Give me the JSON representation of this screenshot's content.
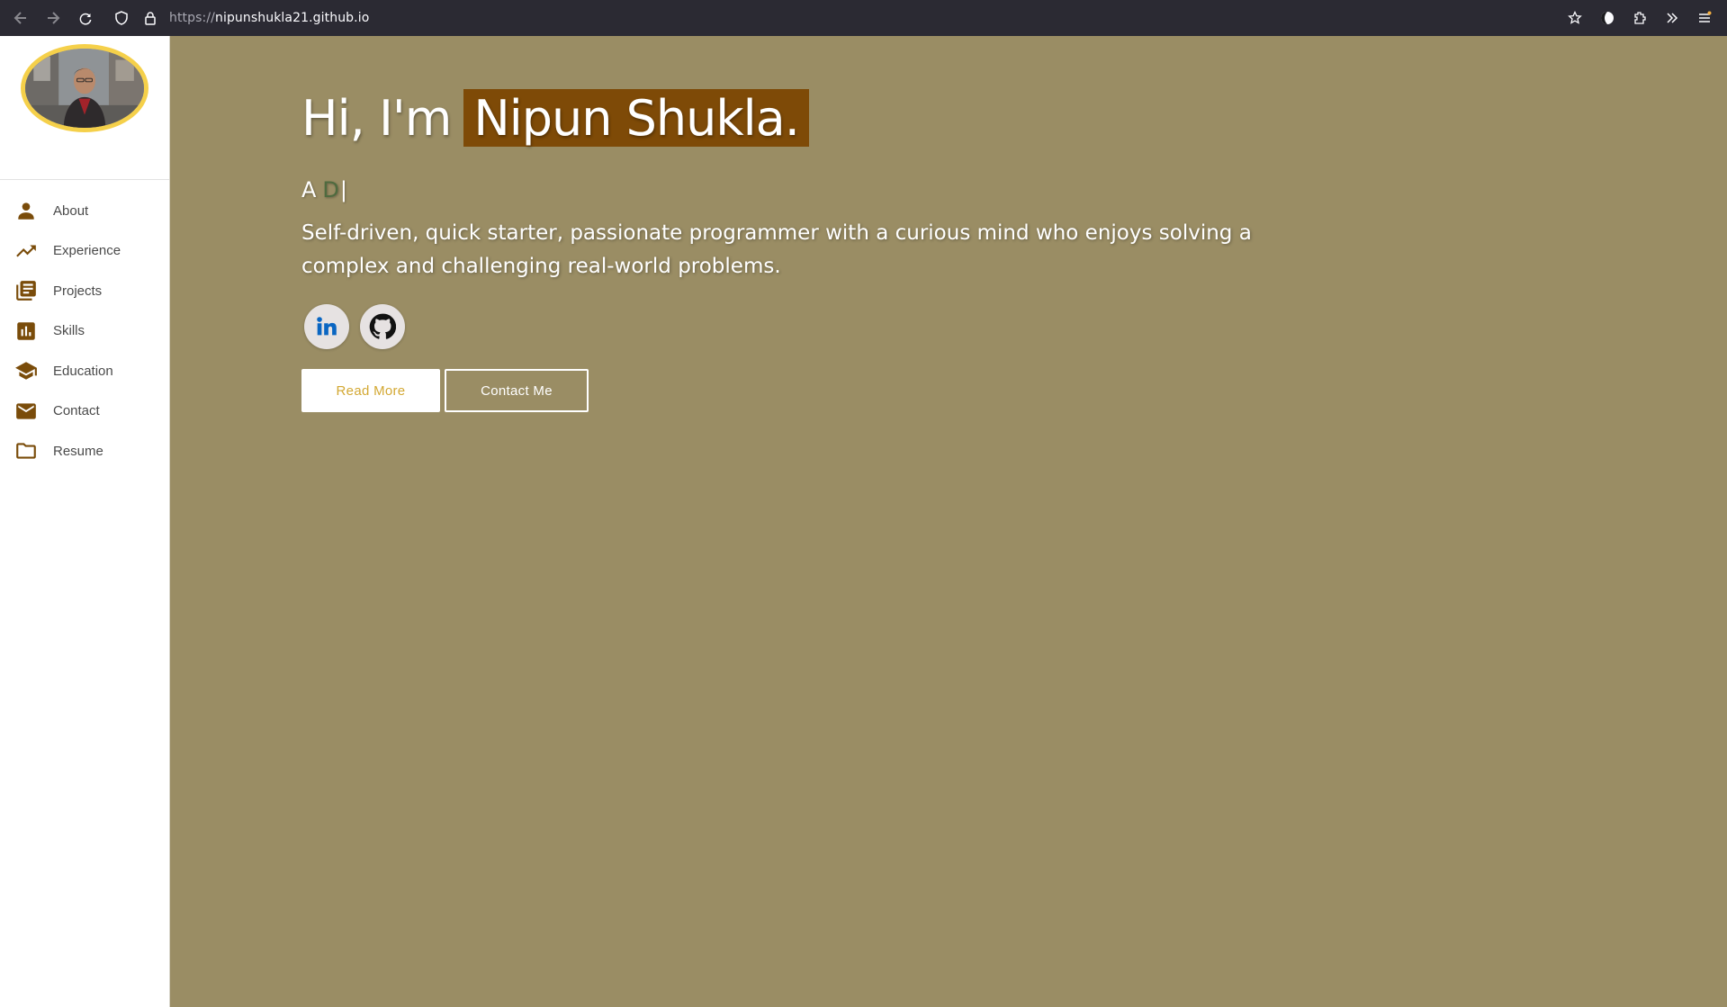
{
  "browser": {
    "url_scheme": "https://",
    "url_host": "nipunshukla21.github.io",
    "icons": [
      "back-icon",
      "forward-icon",
      "reload-icon",
      "shield-icon",
      "lock-icon",
      "bookmark-star-icon",
      "profile-icon",
      "extensions-icon",
      "overflow-icon",
      "menu-icon"
    ]
  },
  "sidebar": {
    "avatar_alt": "profile photo",
    "items": [
      {
        "label": "About",
        "icon": "person-icon"
      },
      {
        "label": "Experience",
        "icon": "trending-up-icon"
      },
      {
        "label": "Projects",
        "icon": "library-books-icon"
      },
      {
        "label": "Skills",
        "icon": "bar-chart-icon"
      },
      {
        "label": "Education",
        "icon": "graduation-cap-icon"
      },
      {
        "label": "Contact",
        "icon": "envelope-icon"
      },
      {
        "label": "Resume",
        "icon": "folder-icon"
      }
    ]
  },
  "hero": {
    "greeting": "Hi, I'm",
    "name": "Nipun Shukla.",
    "typed_prefix": "A",
    "typed_word": "D",
    "typed_cursor": "|",
    "bio": "Self-driven, quick starter, passionate programmer with a curious mind who enjoys solving a complex and challenging real-world problems.",
    "socials": [
      {
        "icon": "linkedin-icon"
      },
      {
        "icon": "github-icon"
      }
    ],
    "read_more_label": "Read More",
    "contact_label": "Contact Me"
  },
  "colors": {
    "accent": "#7e4a07",
    "background": "#9a8d64",
    "avatar_ring": "#f5d04a",
    "read_more_text": "#d3a833"
  }
}
